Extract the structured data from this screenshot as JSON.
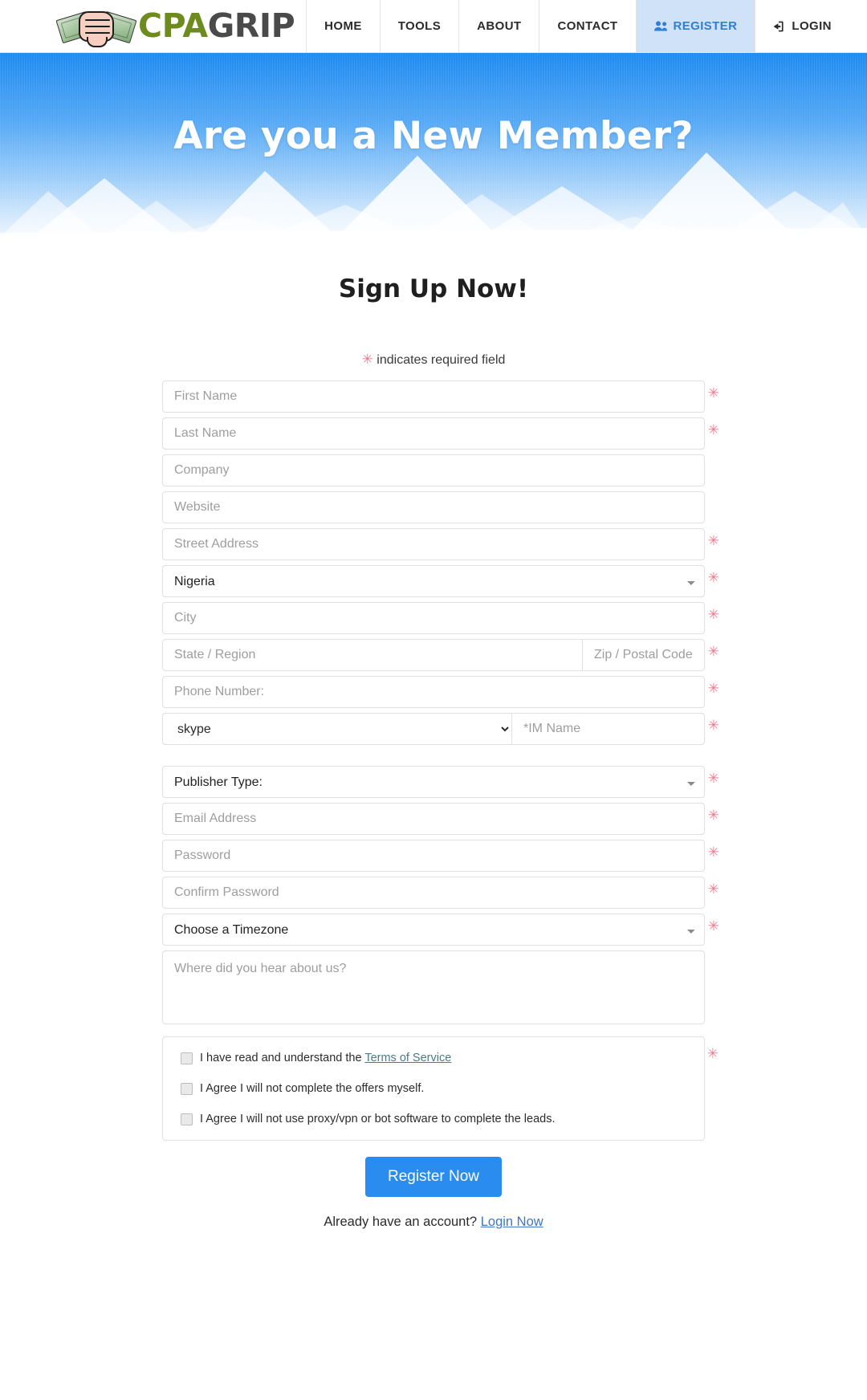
{
  "brand": {
    "logo_cpa": "CPA",
    "logo_grip": "GRIP",
    "accent_blue": "#2b8cf0",
    "logo_green": "#6d8b1f",
    "logo_gray": "#4a4a4a"
  },
  "nav": {
    "items": [
      {
        "label": "HOME",
        "icon": "",
        "active": false
      },
      {
        "label": "TOOLS",
        "icon": "",
        "active": false
      },
      {
        "label": "ABOUT",
        "icon": "",
        "active": false
      },
      {
        "label": "CONTACT",
        "icon": "",
        "active": false
      },
      {
        "label": "REGISTER",
        "icon": "users-icon",
        "active": true
      },
      {
        "label": "LOGIN",
        "icon": "login-arrow-icon",
        "active": false
      }
    ]
  },
  "hero": {
    "title": "Are you a New Member?"
  },
  "form": {
    "heading": "Sign Up Now!",
    "required_star": "✳",
    "required_note": "indicates required field",
    "fields": {
      "first_name": "First Name",
      "last_name": "Last Name",
      "company": "Company",
      "website": "Website",
      "street_address": "Street Address",
      "country_value": "Nigeria",
      "city": "City",
      "state": "State / Region",
      "zip": "Zip / Postal Code",
      "phone": "Phone Number:",
      "im_type_value": "skype",
      "im_name": "*IM Name",
      "publisher_type_value": "Publisher Type:",
      "email": "Email Address",
      "password": "Password",
      "confirm_password": "Confirm Password",
      "timezone_value": "Choose a Timezone",
      "hear_about": "Where did you hear about us?"
    },
    "agreements": [
      {
        "pre": "I have read and understand the ",
        "link": "Terms of Service",
        "post": ""
      },
      {
        "pre": "I Agree I will not complete the offers myself.",
        "link": "",
        "post": ""
      },
      {
        "pre": "I Agree I will not use proxy/vpn or bot software to complete the leads.",
        "link": "",
        "post": ""
      }
    ],
    "submit_label": "Register Now",
    "already_text": "Already have an account?",
    "already_link": "Login Now"
  }
}
